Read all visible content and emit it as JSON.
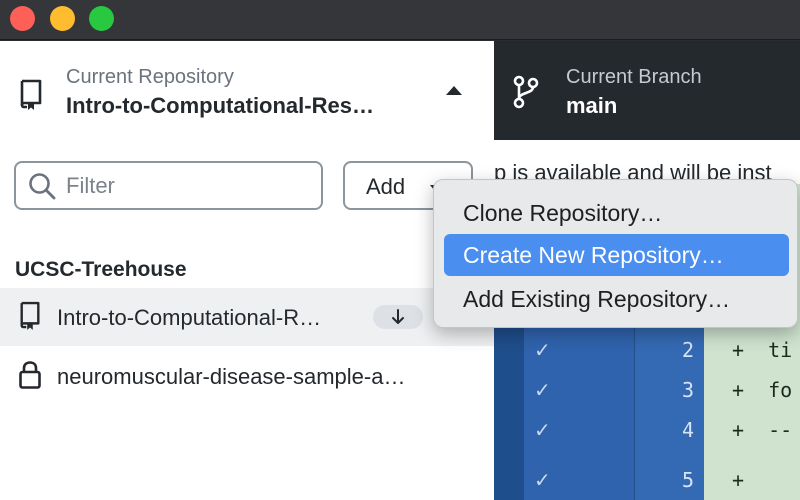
{
  "window": {
    "controls": [
      "close",
      "minimize",
      "zoom"
    ]
  },
  "repository": {
    "caption": "Current Repository",
    "name": "Intro-to-Computational-Res…",
    "icon": "repo-icon"
  },
  "branch": {
    "caption": "Current Branch",
    "name": "main",
    "icon": "git-branch-icon"
  },
  "filter": {
    "placeholder": "Filter",
    "value": ""
  },
  "add_button": {
    "label": "Add"
  },
  "group": {
    "title": "UCSC-Treehouse"
  },
  "repositories": [
    {
      "name": "Intro-to-Computational-R…",
      "icon": "repo-icon",
      "selected": true,
      "badge_icon": "arrow-down-icon"
    },
    {
      "name": "neuromuscular-disease-sample-a…",
      "icon": "lock-icon",
      "selected": false
    }
  ],
  "add_menu": {
    "items": [
      {
        "label": "Clone Repository…",
        "highlighted": false
      },
      {
        "label": "Create New Repository…",
        "highlighted": true
      },
      {
        "label": "Add Existing Repository…",
        "highlighted": false
      }
    ]
  },
  "banner": {
    "text": "p is available and will be inst"
  },
  "diff": {
    "rows": [
      {
        "line": "2",
        "code": "+  ti"
      },
      {
        "line": "3",
        "code": "+  fo"
      },
      {
        "line": "4",
        "code": "+  --"
      },
      {
        "line": "5",
        "code": "+"
      }
    ]
  },
  "colors": {
    "menu_highlight": "#4a8ef0",
    "toolbar_dark": "#24292e",
    "diff_blue": "#2f63ad",
    "diff_added_bg": "#cfe3cf"
  }
}
